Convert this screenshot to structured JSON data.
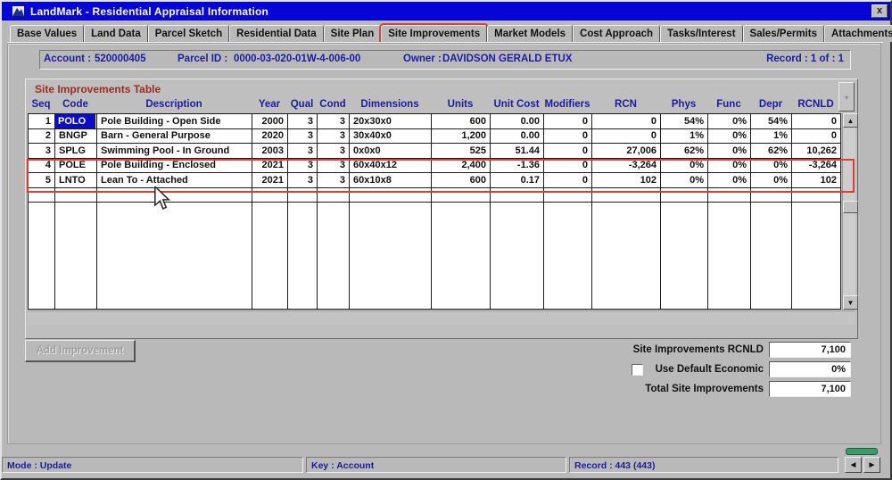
{
  "window": {
    "title": "LandMark - Residential Appraisal Information",
    "close_label": "x"
  },
  "tabs": [
    "Base Values",
    "Land Data",
    "Parcel Sketch",
    "Residential Data",
    "Site Plan",
    "Site Improvements",
    "Market Models",
    "Cost Approach",
    "Tasks/Interest",
    "Sales/Permits",
    "Attachments"
  ],
  "active_tab": "Site Improvements",
  "account_bar": {
    "account_label": "Account :",
    "account_value": "520000405",
    "parcel_label": "Parcel ID :",
    "parcel_value": "0000-03-020-01W-4-006-00",
    "owner_label": "Owner :",
    "owner_value": "DAVIDSON GERALD ETUX",
    "record_label": "Record : 1 of : 1"
  },
  "table": {
    "title": "Site Improvements Table",
    "headers": [
      "Seq",
      "Code",
      "Description",
      "Year",
      "Qual",
      "Cond",
      "Dimensions",
      "Units",
      "Unit Cost",
      "Modifiers",
      "RCN",
      "Phys",
      "Func",
      "Depr",
      "RCNLD"
    ],
    "combo_value": "POLO",
    "combo_arrow": "▼",
    "rows": [
      {
        "seq": "1",
        "code": "POLO",
        "desc": "Pole Building - Open Side",
        "year": "2000",
        "qual": "3",
        "cond": "3",
        "dims": "20x30x0",
        "units": "600",
        "unit_cost": "0.00",
        "modifiers": "0",
        "rcn": "0",
        "phys": "54%",
        "func": "0%",
        "depr": "54%",
        "rcnld": "0"
      },
      {
        "seq": "2",
        "code": "BNGP",
        "desc": "Barn - General Purpose",
        "year": "2020",
        "qual": "3",
        "cond": "3",
        "dims": "30x40x0",
        "units": "1,200",
        "unit_cost": "0.00",
        "modifiers": "0",
        "rcn": "0",
        "phys": "1%",
        "func": "0%",
        "depr": "1%",
        "rcnld": "0"
      },
      {
        "seq": "3",
        "code": "SPLG",
        "desc": "Swimming Pool - In Ground",
        "year": "2003",
        "qual": "3",
        "cond": "3",
        "dims": "0x0x0",
        "units": "525",
        "unit_cost": "51.44",
        "modifiers": "0",
        "rcn": "27,006",
        "phys": "62%",
        "func": "0%",
        "depr": "62%",
        "rcnld": "10,262"
      },
      {
        "seq": "4",
        "code": "POLE",
        "desc": "Pole Building - Enclosed",
        "year": "2021",
        "qual": "3",
        "cond": "3",
        "dims": "60x40x12",
        "units": "2,400",
        "unit_cost": "-1.36",
        "modifiers": "0",
        "rcn": "-3,264",
        "phys": "0%",
        "func": "0%",
        "depr": "0%",
        "rcnld": "-3,264"
      },
      {
        "seq": "5",
        "code": "LNTO",
        "desc": "Lean To - Attached",
        "year": "2021",
        "qual": "3",
        "cond": "3",
        "dims": "60x10x8",
        "units": "600",
        "unit_cost": "0.17",
        "modifiers": "0",
        "rcn": "102",
        "phys": "0%",
        "func": "0%",
        "depr": "0%",
        "rcnld": "102"
      }
    ]
  },
  "annotations": {
    "highlighted_tab": "Site Improvements",
    "highlighted_row_seqs": [
      "4",
      "5"
    ]
  },
  "buttons": {
    "add_improvement": "Add Improvement"
  },
  "summary": {
    "rcnld_label": "Site Improvements RCNLD",
    "rcnld_value": "7,100",
    "economic_label": "Use Default Economic",
    "economic_value": "0%",
    "total_label": "Total Site Improvements",
    "total_value": "7,100"
  },
  "status_bar": {
    "mode": "Mode : Update",
    "key": "Key : Account",
    "record": "Record : 443 (443)"
  },
  "scrollbar": {
    "up": "▲",
    "down": "▼"
  },
  "nav": {
    "prev": "◄",
    "next": "►"
  },
  "colors": {
    "titlebar_blue": "#0505d8",
    "navy_text": "#1c1c9e",
    "dark_red_title": "#9b2c22",
    "annotation_red": "#e23b33",
    "selection_blue": "#0b0bcc",
    "green_indicator": "#3d9a6b",
    "background_gray": "#b9b9b9"
  }
}
